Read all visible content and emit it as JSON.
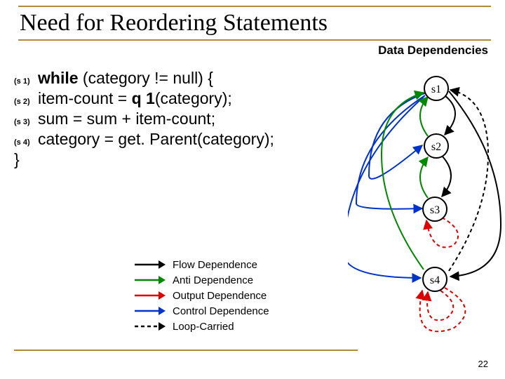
{
  "title": "Need for Reordering Statements",
  "subtitle": "Data Dependencies",
  "code": {
    "s1_label": "(s 1)",
    "s1_kw": "while",
    "s1_rest": " (category != null) {",
    "s2_label": "(s 2)",
    "s2_pre": "  item-count = ",
    "s2_bold": "q 1",
    "s2_post": "(category);",
    "s3_label": "(s 3)",
    "s3": "  sum = sum + item-count;",
    "s4_label": "(s 4)",
    "s4": "  category = get. Parent(category);",
    "close": "}"
  },
  "legend": {
    "flow": "Flow Dependence",
    "anti": "Anti Dependence",
    "output": "Output Dependence",
    "control": "Control Dependence",
    "loop": "Loop-Carried"
  },
  "nodes": {
    "s1": "s1",
    "s2": "s2",
    "s3": "s3",
    "s4": "s4"
  },
  "page": "22",
  "chart_data": {
    "type": "graph",
    "nodes": [
      "s1",
      "s2",
      "s3",
      "s4"
    ],
    "edges": [
      {
        "from": "s1",
        "to": "s2",
        "kind": "control"
      },
      {
        "from": "s1",
        "to": "s3",
        "kind": "control"
      },
      {
        "from": "s1",
        "to": "s4",
        "kind": "control"
      },
      {
        "from": "s1",
        "to": "s2",
        "kind": "flow"
      },
      {
        "from": "s1",
        "to": "s4",
        "kind": "flow"
      },
      {
        "from": "s2",
        "to": "s3",
        "kind": "flow"
      },
      {
        "from": "s4",
        "to": "s1",
        "kind": "flow",
        "loop_carried": true
      },
      {
        "from": "s2",
        "to": "s1",
        "kind": "anti"
      },
      {
        "from": "s3",
        "to": "s2",
        "kind": "anti"
      },
      {
        "from": "s4",
        "to": "s1",
        "kind": "anti"
      },
      {
        "from": "s3",
        "to": "s3",
        "kind": "output",
        "loop_carried": true
      },
      {
        "from": "s4",
        "to": "s4",
        "kind": "output",
        "loop_carried": true
      }
    ],
    "legend": [
      {
        "kind": "flow",
        "color": "black",
        "label": "Flow Dependence"
      },
      {
        "kind": "anti",
        "color": "green",
        "label": "Anti Dependence"
      },
      {
        "kind": "output",
        "color": "red",
        "label": "Output Dependence"
      },
      {
        "kind": "control",
        "color": "blue",
        "label": "Control Dependence"
      },
      {
        "kind": "loop",
        "style": "dashed",
        "label": "Loop-Carried"
      }
    ]
  }
}
